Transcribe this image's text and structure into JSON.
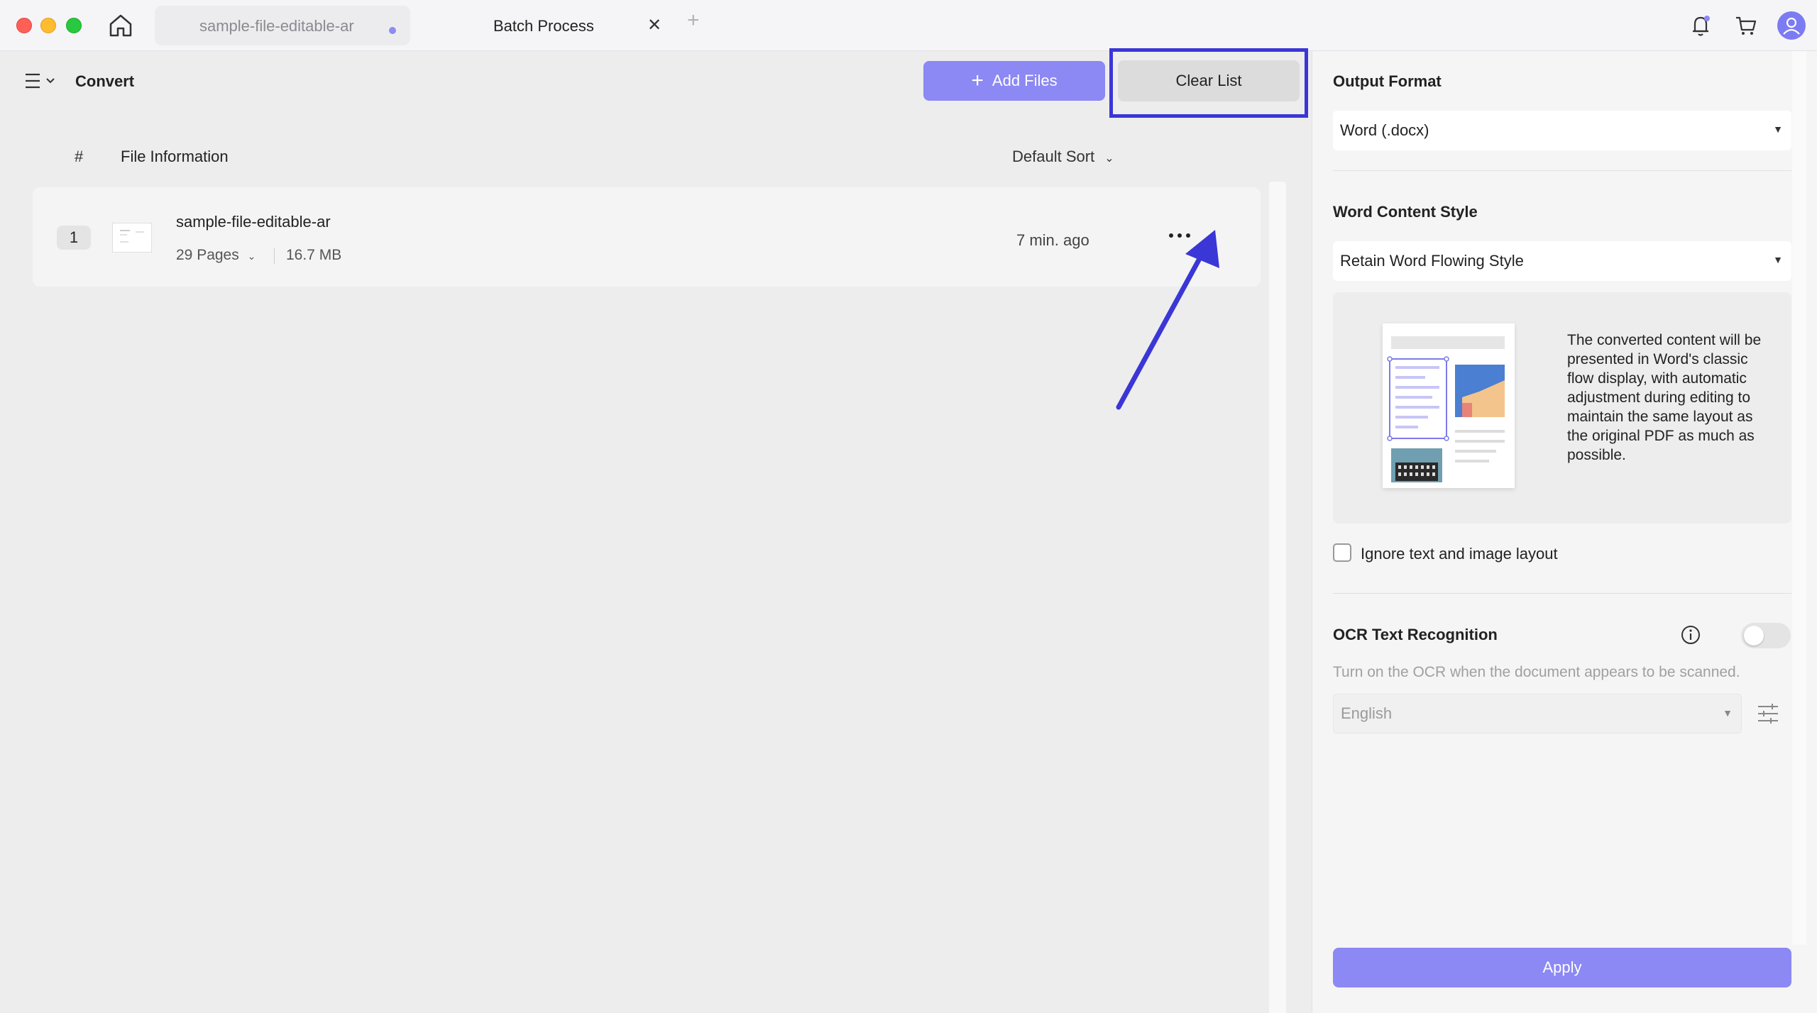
{
  "tabs": {
    "file_tab": "sample-file-editable-ar",
    "batch_tab": "Batch Process",
    "close_glyph": "✕",
    "add_glyph": "+"
  },
  "toolbar": {
    "title": "Convert",
    "add_files": "Add Files",
    "add_glyph": "+",
    "clear_list": "Clear List"
  },
  "list": {
    "col_number": "#",
    "col_info": "File Information",
    "sort_label": "Default Sort",
    "rows": [
      {
        "number": "1",
        "name": "sample-file-editable-ar",
        "pages": "29 Pages",
        "size": "16.7 MB",
        "time": "7 min. ago"
      }
    ]
  },
  "settings": {
    "output_format_heading": "Output Format",
    "output_format_value": "Word (.docx)",
    "content_style_heading": "Word Content Style",
    "content_style_value": "Retain Word Flowing Style",
    "style_description": "The converted content will be presented in Word's classic flow display, with automatic adjustment during editing to maintain the same layout as the original PDF as much as possible.",
    "ignore_layout_label": "Ignore text and image layout",
    "ignore_layout_checked": false,
    "ocr_heading": "OCR Text Recognition",
    "ocr_enabled": false,
    "ocr_description": "Turn on the OCR when the document appears to be scanned.",
    "ocr_language": "English",
    "apply": "Apply"
  },
  "colors": {
    "accent": "#8c88f4",
    "highlight_box": "#3b36d6",
    "annotation_arrow": "#3b36d6"
  }
}
